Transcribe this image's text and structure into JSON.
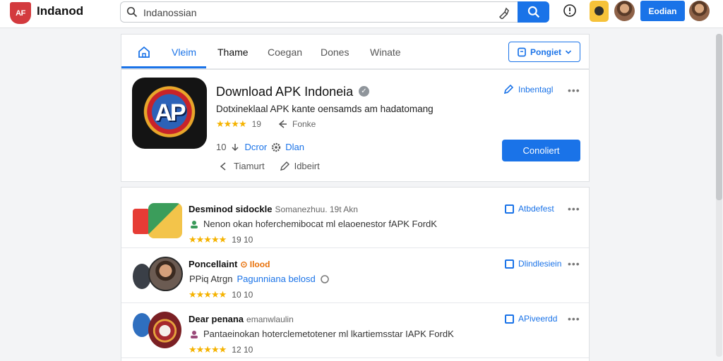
{
  "header": {
    "logo_text": "AF",
    "brand": "Indanod",
    "search_value": "Indanossian",
    "signin_label": "Eodian"
  },
  "tabs": {
    "items": [
      "Vleim",
      "Thame",
      "Coegan",
      "Dones",
      "Winate"
    ],
    "dropdown_label": "Pongiet"
  },
  "app": {
    "icon_text": "AP",
    "title": "Download APK Indoneia",
    "verified": "✓",
    "description": "Dotxineklaal APK kante oensamds am hadatomang",
    "rating_stars": "★★★★",
    "rating_value": "19",
    "share_label": "Fonke",
    "install_count": "10",
    "developer_label": "Dcror",
    "developer_name": "Dlan",
    "action1": "Tiamurt",
    "action2": "Idbeirt",
    "report_label": "Inbentagl",
    "primary_button": "Conoliert"
  },
  "list": [
    {
      "title": "Desminod sidockle",
      "subtitle": "Somanezhuu. 19t Akn",
      "description": "Nenon okan hoferchemibocat ml elaoenestor fAPK FordK",
      "rating": "★★★★★",
      "count": "19 10",
      "action": "Atbdefest"
    },
    {
      "title": "Poncellaint",
      "subtitle": "Ilood",
      "description_prefix": "PPiq Atrgn",
      "description_link": "Pagunniana belosd",
      "rating": "★★★★★",
      "count": "10 10",
      "action": "Dlindlesiein"
    },
    {
      "title": "Dear penana",
      "subtitle": "emanwlaulin",
      "description": "Pantaeinokan hoterclemetotener ml lkartiemsstar IAPK FordK",
      "rating": "★★★★★",
      "count": "12 10",
      "action": "APiveerdd"
    }
  ],
  "colors": {
    "accent": "#1a73e8",
    "star": "#f5b301",
    "logo": "#d33a3e"
  },
  "icons": [
    "search-icon",
    "microphone-icon",
    "info-icon",
    "home-icon",
    "bookmark-icon",
    "verified-icon",
    "share-icon",
    "gear-icon",
    "edit-icon",
    "more-icon"
  ]
}
